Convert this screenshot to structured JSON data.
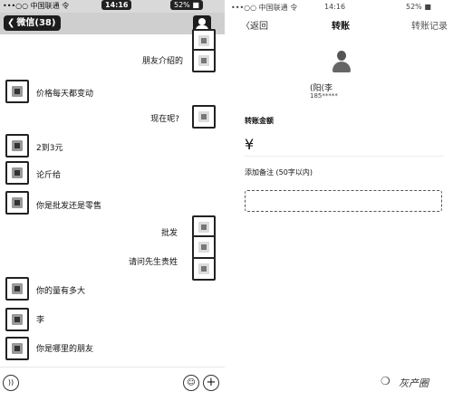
{
  "left": {
    "status": {
      "carrier": "•••○○ 中国联通 令",
      "time": "14:16",
      "battery": "52% ■"
    },
    "nav": {
      "back_label": "微信(38)"
    },
    "messages": [
      {
        "side": "right",
        "text": "朋友介绍的"
      },
      {
        "side": "left",
        "text": "价格每天都变动"
      },
      {
        "side": "right",
        "text": "现在呢?"
      },
      {
        "side": "left",
        "text": "2到3元"
      },
      {
        "side": "left",
        "text": "论斤给"
      },
      {
        "side": "left",
        "text": "你是批发还是零售"
      },
      {
        "side": "right",
        "text": "批发"
      },
      {
        "side": "right",
        "text": "请问先生贵姓"
      },
      {
        "side": "left",
        "text": "你的量有多大"
      },
      {
        "side": "left",
        "text": "李"
      },
      {
        "side": "left",
        "text": "你是哪里的朋友"
      }
    ],
    "input": {
      "voice_icon": "voice-icon",
      "emoji_icon": "emoji-icon",
      "plus_icon": "plus-icon"
    }
  },
  "right": {
    "status": {
      "carrier": "•••○○ 中国联通 令",
      "time": "14:16",
      "battery": "52% ■"
    },
    "nav": {
      "back_label": "〈返回",
      "title": "转账",
      "action_label": "转账记录"
    },
    "payee": {
      "name": "(阳(李",
      "phone": "185*****"
    },
    "amount_label": "转账金额",
    "currency_symbol": "¥",
    "note_label": "添加备注 (50字以内)"
  },
  "watermark": {
    "text": "灰产圈"
  }
}
